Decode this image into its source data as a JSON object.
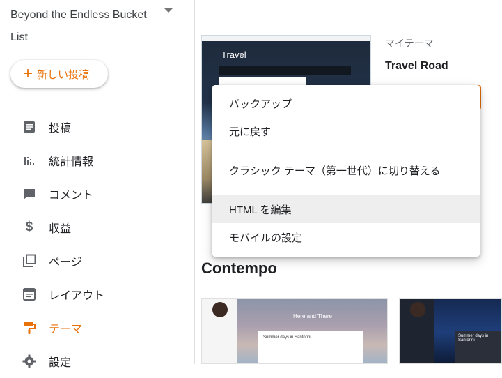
{
  "sidebar": {
    "blog_title": "Beyond the Endless Bucket List",
    "new_post_label": "新しい投稿",
    "items": [
      {
        "label": "投稿",
        "icon": "posts-icon"
      },
      {
        "label": "統計情報",
        "icon": "stats-icon"
      },
      {
        "label": "コメント",
        "icon": "comment-icon"
      },
      {
        "label": "収益",
        "icon": "dollar-icon"
      },
      {
        "label": "ページ",
        "icon": "pages-icon"
      },
      {
        "label": "レイアウト",
        "icon": "layout-icon"
      },
      {
        "label": "テーマ",
        "icon": "paint-roller-icon",
        "active": true
      },
      {
        "label": "設定",
        "icon": "gear-icon"
      }
    ]
  },
  "main": {
    "my_theme_label": "マイテーマ",
    "my_theme_name": "Travel Road",
    "current_theme_thumb_title": "Travel",
    "section_title": "Contempo",
    "thumb_here_and_there": "Here and There",
    "thumb_post_title": "Summer days in Santorini",
    "thumb3_post_title": "Summer days in Santorini"
  },
  "context_menu": {
    "items": [
      "バックアップ",
      "元に戻す",
      "クラシック テーマ（第一世代）に切り替える",
      "HTML を編集",
      "モバイルの設定"
    ],
    "hovered_index": 3
  },
  "colors": {
    "accent": "#e8710a"
  }
}
